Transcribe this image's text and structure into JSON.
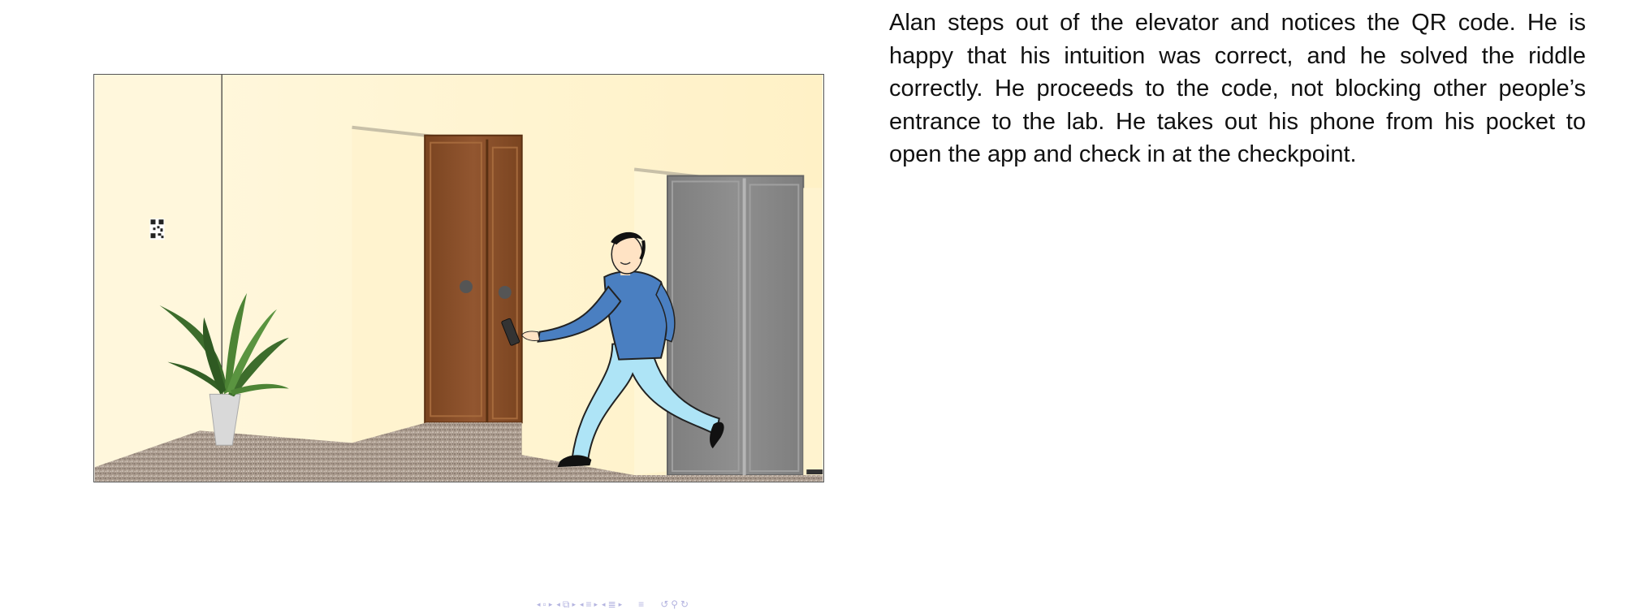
{
  "slide": {
    "paragraph": "Alan steps out of the elevator and notices the QR code.  He is happy that his intuition was correct, and he solved the riddle correctly.  He proceeds to the code, not blocking other people’s entrance to the lab.  He takes out his phone from his pocket to open the app and check in at the checkpoint."
  },
  "illustration": {
    "wall_color": "#fff1c6",
    "wood_door_color": "#8b5028",
    "elevator_door_color": "#8a8a8a",
    "shirt_color": "#4a7fc1",
    "pants_color": "#aee4f6",
    "plant_color": "#3d6d2c",
    "floor_color": "#a8998d",
    "icons": [
      "qr-code-icon",
      "potted-plant-icon",
      "smartphone-icon"
    ]
  },
  "nav": {
    "color": "#b4b4e0",
    "icons": [
      "nav-first-icon",
      "nav-frame-icon",
      "nav-section-icon",
      "nav-subsection-icon",
      "nav-subsubsection-icon",
      "nav-toc-icon",
      "nav-search-icon"
    ]
  }
}
